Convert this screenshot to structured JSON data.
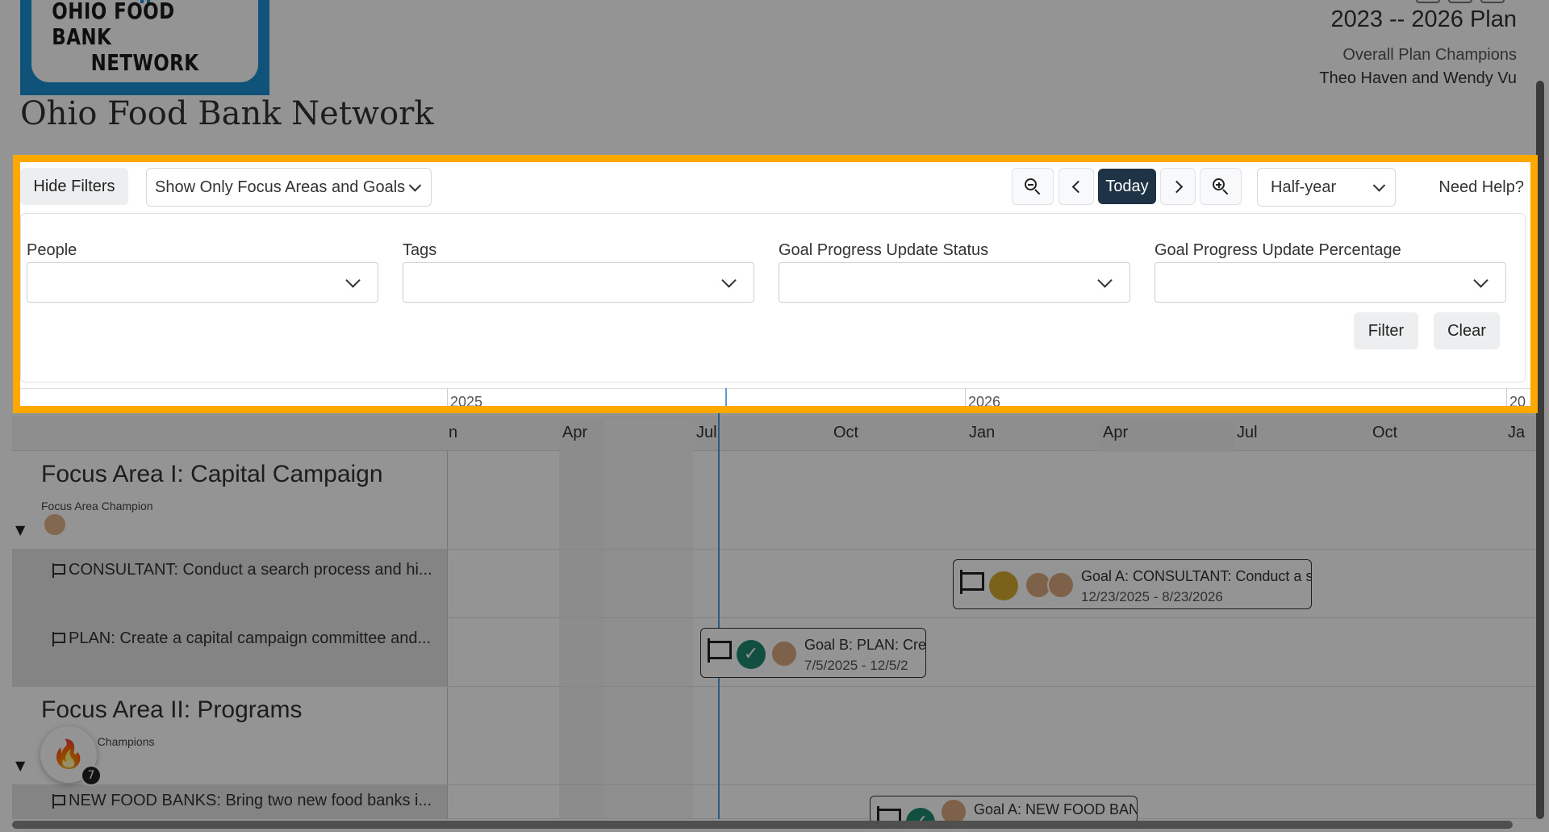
{
  "header": {
    "logo_line1": "OHIO FOOD BANK",
    "logo_line2": "NETWORK",
    "org_name": "Ohio Food Bank Network",
    "plan_title": "2023 -- 2026 Plan",
    "champions_label": "Overall Plan Champions",
    "champions_names": "Theo Haven and Wendy Vu"
  },
  "toolbar": {
    "hide_filters": "Hide Filters",
    "view_select": "Show Only Focus Areas and Goals",
    "today": "Today",
    "scale_select": "Half-year",
    "help": "Need Help?"
  },
  "filters": {
    "people_label": "People",
    "tags_label": "Tags",
    "status_label": "Goal Progress Update Status",
    "percentage_label": "Goal Progress Update Percentage",
    "filter_button": "Filter",
    "clear_button": "Clear"
  },
  "timeline": {
    "years": [
      "2025",
      "2026",
      "20"
    ],
    "months": [
      "n",
      "Apr",
      "Jul",
      "Oct",
      "Jan",
      "Apr",
      "Jul",
      "Oct",
      "Ja"
    ]
  },
  "focus_areas": [
    {
      "title": "Focus Area I: Capital Campaign",
      "champion_label": "Focus Area Champion",
      "goals": [
        {
          "label": "CONSULTANT: Conduct a search process and hi...",
          "bar_title": "Goal A: CONSULTANT: Conduct a s",
          "bar_dates": "12/23/2025 - 8/23/2026",
          "status_color": "#d4a92f"
        },
        {
          "label": "PLAN: Create a capital campaign committee and...",
          "bar_title": "Goal B: PLAN: Crea",
          "bar_dates": "7/5/2025 - 12/5/2",
          "status_color": "#1e8a6e"
        }
      ]
    },
    {
      "title": "Focus Area II: Programs",
      "champion_label": "a Champions",
      "goals": [
        {
          "label": "NEW FOOD BANKS: Bring two new food banks i...",
          "bar_title": "Goal A: NEW FOOD BAN",
          "status_color": "#1e8a6e"
        }
      ]
    }
  ],
  "fire_badge": "7",
  "icons": {
    "zoom_out": "zoom-out-icon",
    "zoom_in": "zoom-in-icon",
    "prev": "chevron-left-icon",
    "next": "chevron-right-icon",
    "flag": "flag-icon",
    "fire": "fire-icon"
  },
  "colors": {
    "highlight_border": "#ffa800",
    "today_button": "#1f3346",
    "logo_blue": "#1d8fd2"
  }
}
